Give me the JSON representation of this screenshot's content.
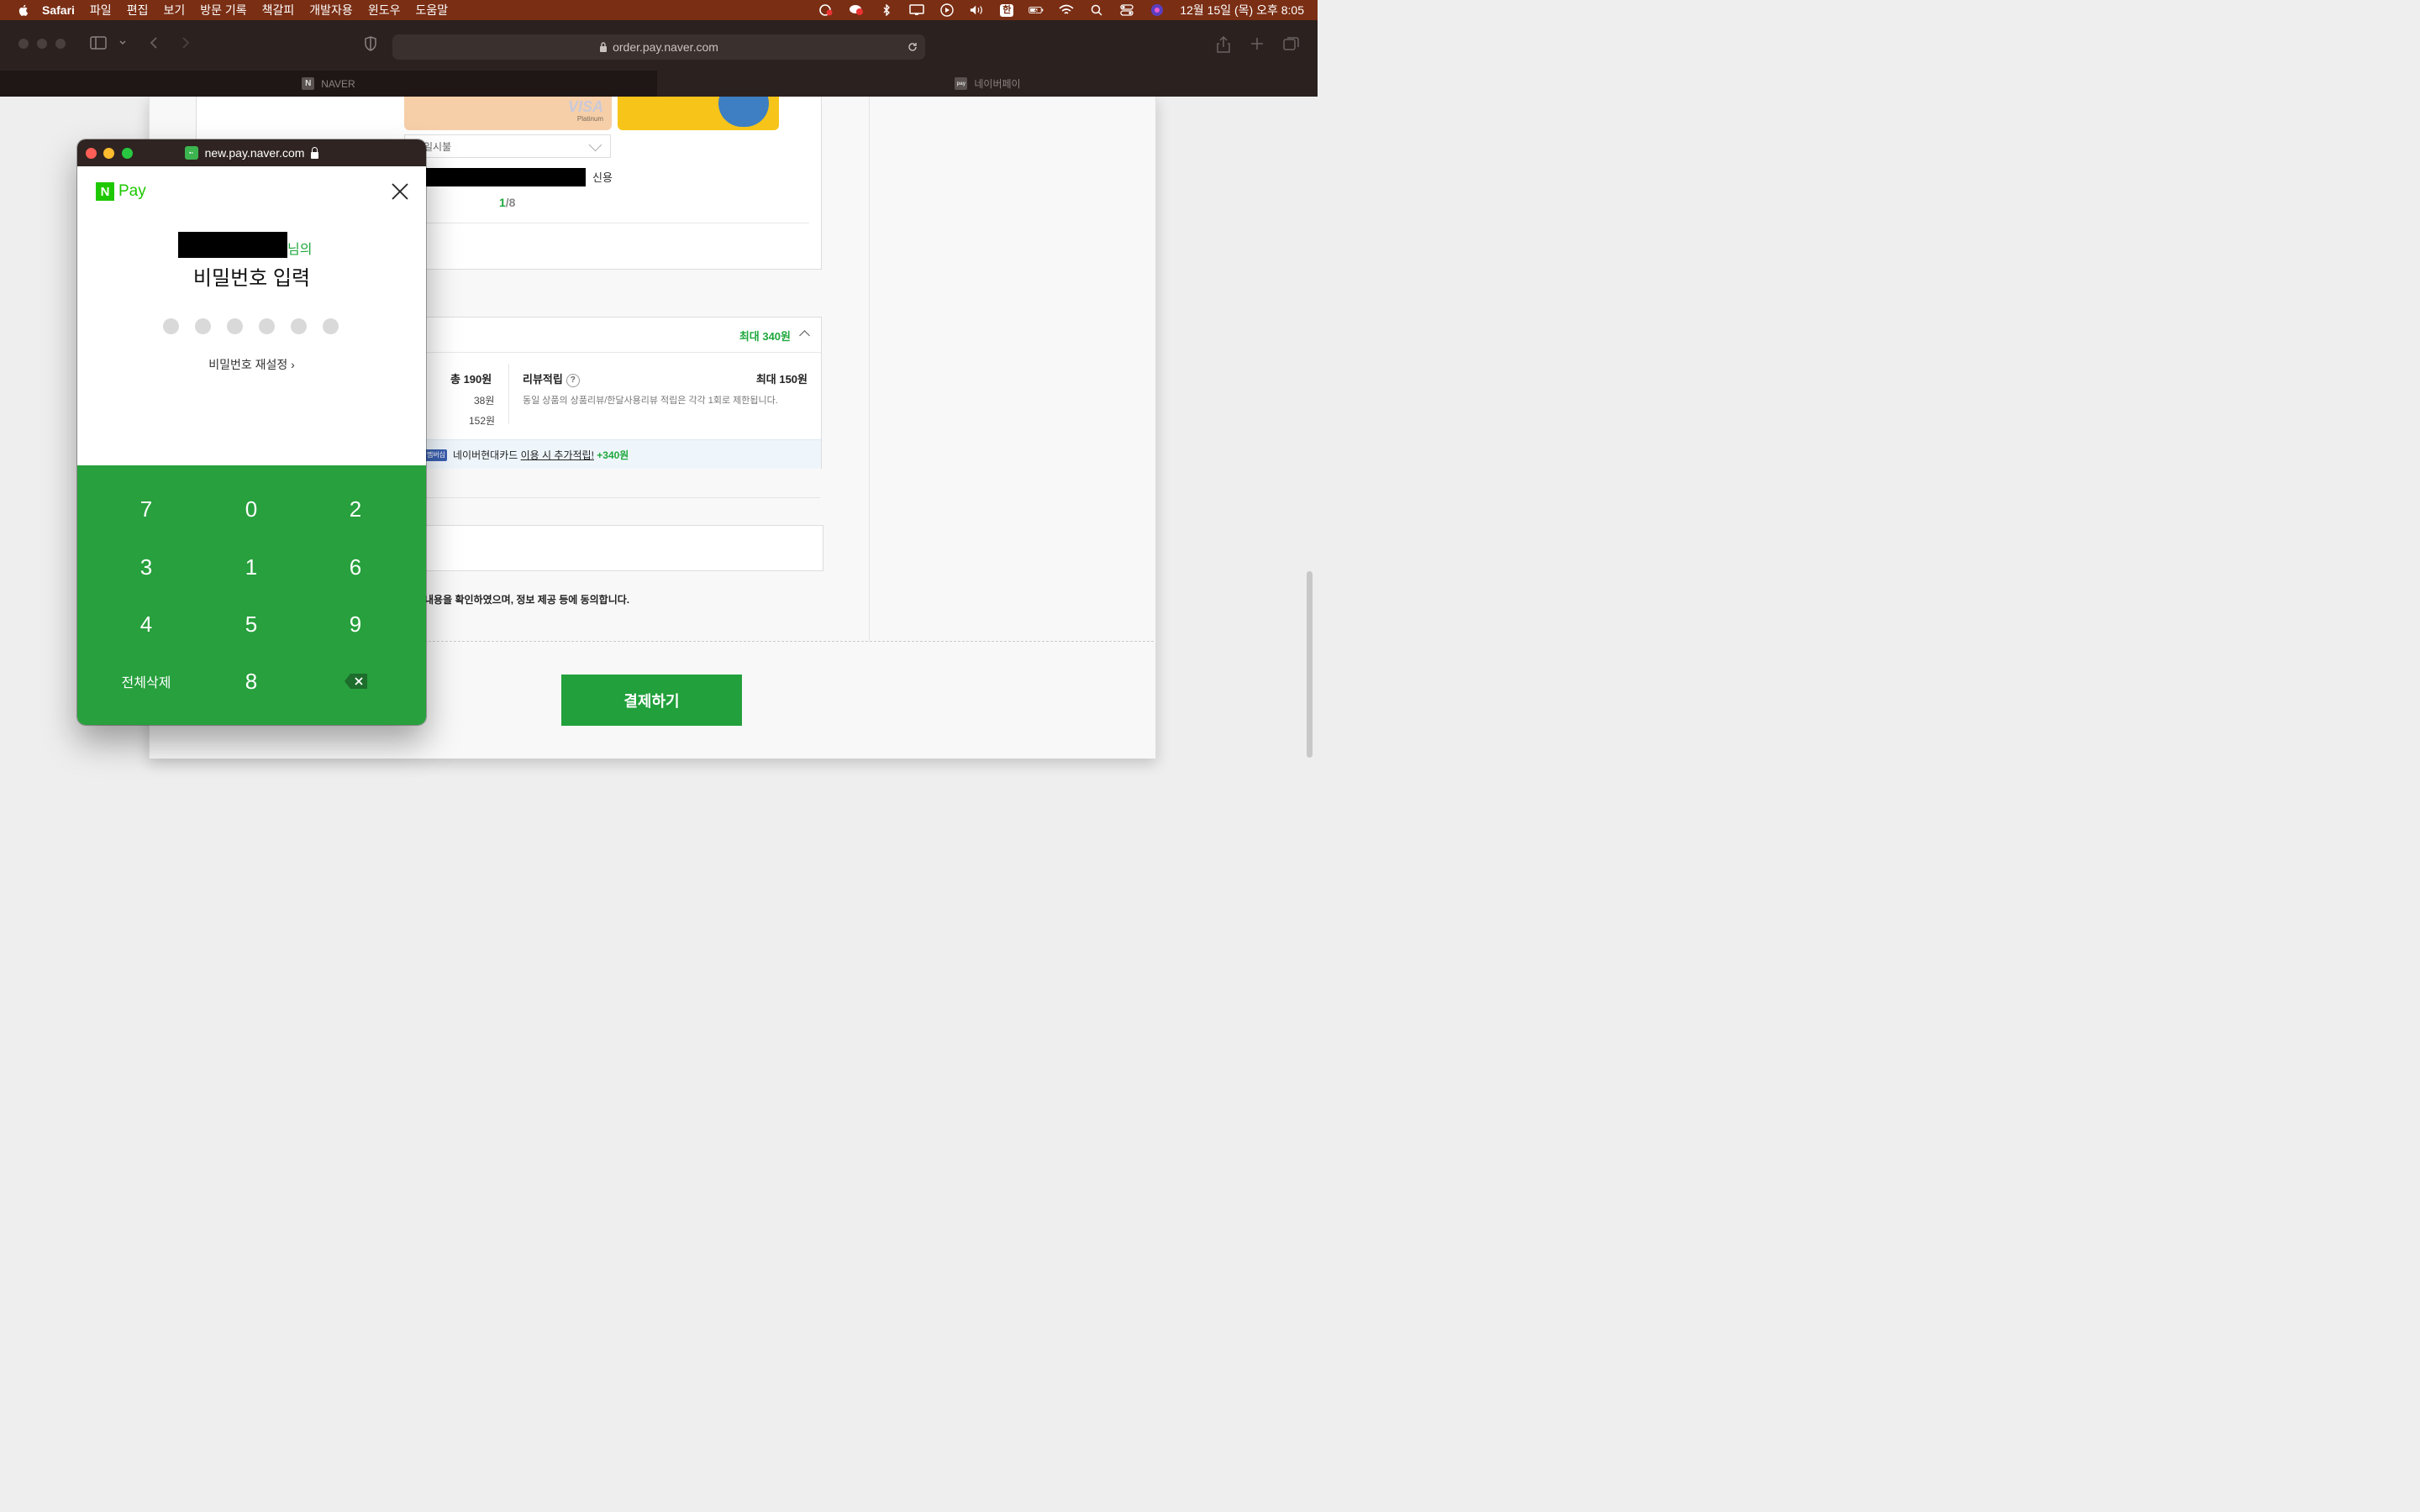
{
  "menubar": {
    "app": "Safari",
    "items": [
      "파일",
      "편집",
      "보기",
      "방문 기록",
      "책갈피",
      "개발자용",
      "윈도우",
      "도움말"
    ],
    "ime": "한",
    "clock": "12월 15일 (목) 오후 8:05"
  },
  "browser": {
    "url": "order.pay.naver.com",
    "tabs": [
      {
        "label": "NAVER",
        "favicon": "N"
      },
      {
        "label": "네이버페이",
        "favicon": "pay"
      }
    ]
  },
  "payment_page": {
    "card": {
      "brand": "VISA",
      "tier": "Platinum"
    },
    "installment_label": "일시불",
    "credit_label": "신용",
    "pager_current": "1",
    "pager_total": "/8",
    "points": {
      "max_label": "최대 340원",
      "total_label": "총 190원",
      "row1": "38원",
      "row2": "152원",
      "review_label": "리뷰적립",
      "review_help": "?",
      "review_max": "최대 150원",
      "review_note": "동일 상품의 상품리뷰/한달사용리뷰 적립은 각각 1회로 제한됩니다.",
      "promo_badge": "멤버십",
      "promo_prefix": "네이버현대카드 ",
      "promo_link": "이용 시 추가적립!",
      "promo_amount": " +340원"
    },
    "agree_text": "내용을 확인하였으며, 정보 제공 등에 동의합니다.",
    "pay_button": "결제하기"
  },
  "popup": {
    "window_title": "new.pay.naver.com",
    "logo_n": "N",
    "logo_pay": "Pay",
    "name_suffix": "님의",
    "title": "비밀번호 입력",
    "reset_link": "비밀번호 재설정 ›",
    "keypad": {
      "row1": [
        "7",
        "0",
        "2"
      ],
      "row2": [
        "3",
        "1",
        "6"
      ],
      "row3": [
        "4",
        "5",
        "9"
      ],
      "clear_all": "전체삭제",
      "last_digit": "8"
    }
  }
}
